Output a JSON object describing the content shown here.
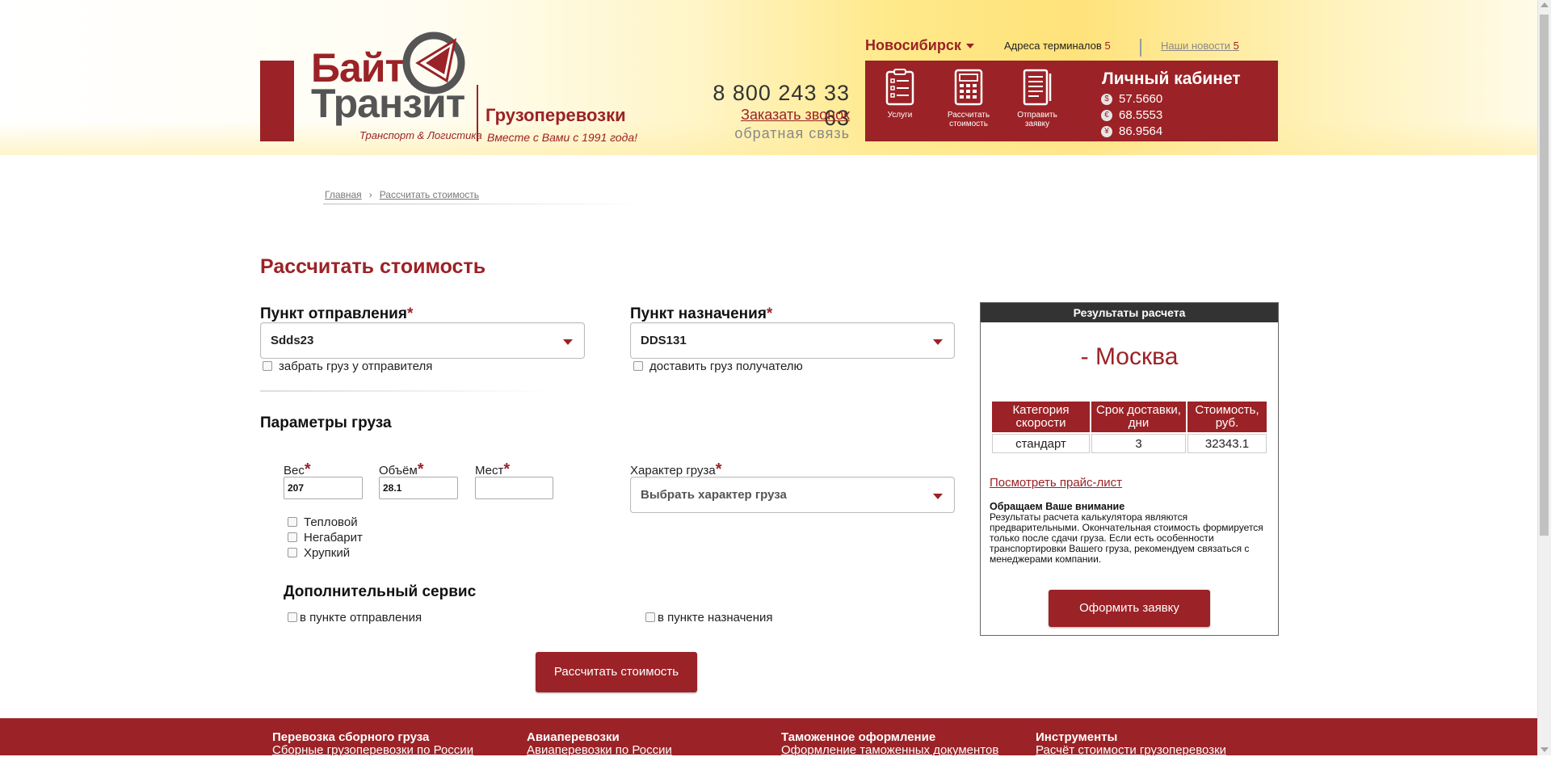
{
  "logo": {
    "word1": "Байт",
    "word2": "Транзит",
    "tagline": "Транспорт & Логистика",
    "service": "Грузоперевозки",
    "motto": "Вместе с Вами с 1991 года!"
  },
  "contacts": {
    "phone": "8 800 243 33 63",
    "callback": "Заказать звонок",
    "feedback": "обратная связь"
  },
  "topbar": {
    "city": "Новосибирск",
    "terminals_label": "Адреса терминалов",
    "terminals_count": "5",
    "news_label": "Наши новости",
    "news_count": "5"
  },
  "panel": {
    "buttons": [
      {
        "label": "Услуги",
        "icon": "list-icon"
      },
      {
        "label": "Рассчитать стоимость",
        "icon": "calculator-icon"
      },
      {
        "label": "Отправить заявку",
        "icon": "document-icon"
      }
    ],
    "cabinet_title": "Личный кабинет",
    "rates": [
      {
        "symbol": "$",
        "value": "57.5660"
      },
      {
        "symbol": "€",
        "value": "68.5553"
      },
      {
        "symbol": "¥",
        "value": "86.9564"
      }
    ]
  },
  "breadcrumb": [
    "Главная",
    "Рассчитать стоимость"
  ],
  "page_title": "Рассчитать стоимость",
  "form": {
    "origin_label": "Пункт отправления",
    "origin_value": "Sdds23",
    "origin_pickup": "забрать груз у отправителя",
    "dest_label": "Пункт назначения",
    "dest_value": "DDS131",
    "dest_delivery": "доставить груз получателю",
    "params_title": "Параметры груза",
    "weight_label": "Вес",
    "weight_value": "207",
    "volume_label": "Объём",
    "volume_value": "28.1",
    "places_label": "Мест",
    "places_value": "",
    "cargo_type_label": "Характер груза",
    "cargo_type_placeholder": "Выбрать характер груза",
    "options": [
      "Тепловой",
      "Негабарит",
      "Хрупкий"
    ],
    "extra_title": "Дополнительный сервис",
    "extra_origin": "в пункте отправления",
    "extra_dest": "в пункте назначения",
    "submit": "Рассчитать стоимость"
  },
  "results": {
    "header": "Результаты расчета",
    "city": "- Москва",
    "table_headers": [
      "Категория скорости",
      "Срок доставки, дни",
      "Стоимость, руб."
    ],
    "rows": [
      [
        "стандарт",
        "3",
        "32343.1"
      ]
    ],
    "pricelist": "Посмотреть прайс-лист",
    "note_title": "Обращаем Ваше внимание",
    "note_text": "Результаты расчета калькулятора являются предварительными. Окончательная стоимость формируется только после сдачи груза. Если есть особенности транспортировки Вашего груза, рекомендуем связаться с менеджерами компании.",
    "order_button": "Оформить заявку"
  },
  "footer": [
    {
      "title": "Перевозка сборного груза",
      "link": "Сборные грузоперевозки по России"
    },
    {
      "title": "Авиаперевозки",
      "link": "Авиаперевозки по России"
    },
    {
      "title": "Таможенное оформление",
      "link": "Оформление таможенных документов"
    },
    {
      "title": "Инструменты",
      "link": "Расчёт стоимости грузоперевозки"
    }
  ],
  "colors": {
    "brand": "#9b2226",
    "dark": "#333333"
  }
}
